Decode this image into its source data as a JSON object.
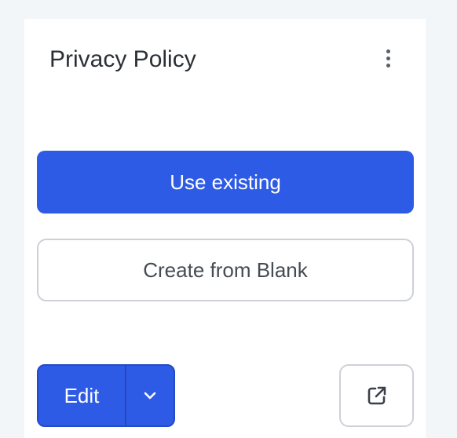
{
  "card": {
    "title": "Privacy Policy",
    "menu_icon": "more-vertical-icon"
  },
  "actions": {
    "use_existing_label": "Use existing",
    "create_blank_label": "Create from Blank"
  },
  "footer": {
    "edit_label": "Edit",
    "dropdown_icon": "chevron-down-icon",
    "open_external_icon": "external-link-icon"
  },
  "colors": {
    "primary": "#2e5be5",
    "background": "#f3f6f9",
    "border": "#cdd1d6"
  }
}
